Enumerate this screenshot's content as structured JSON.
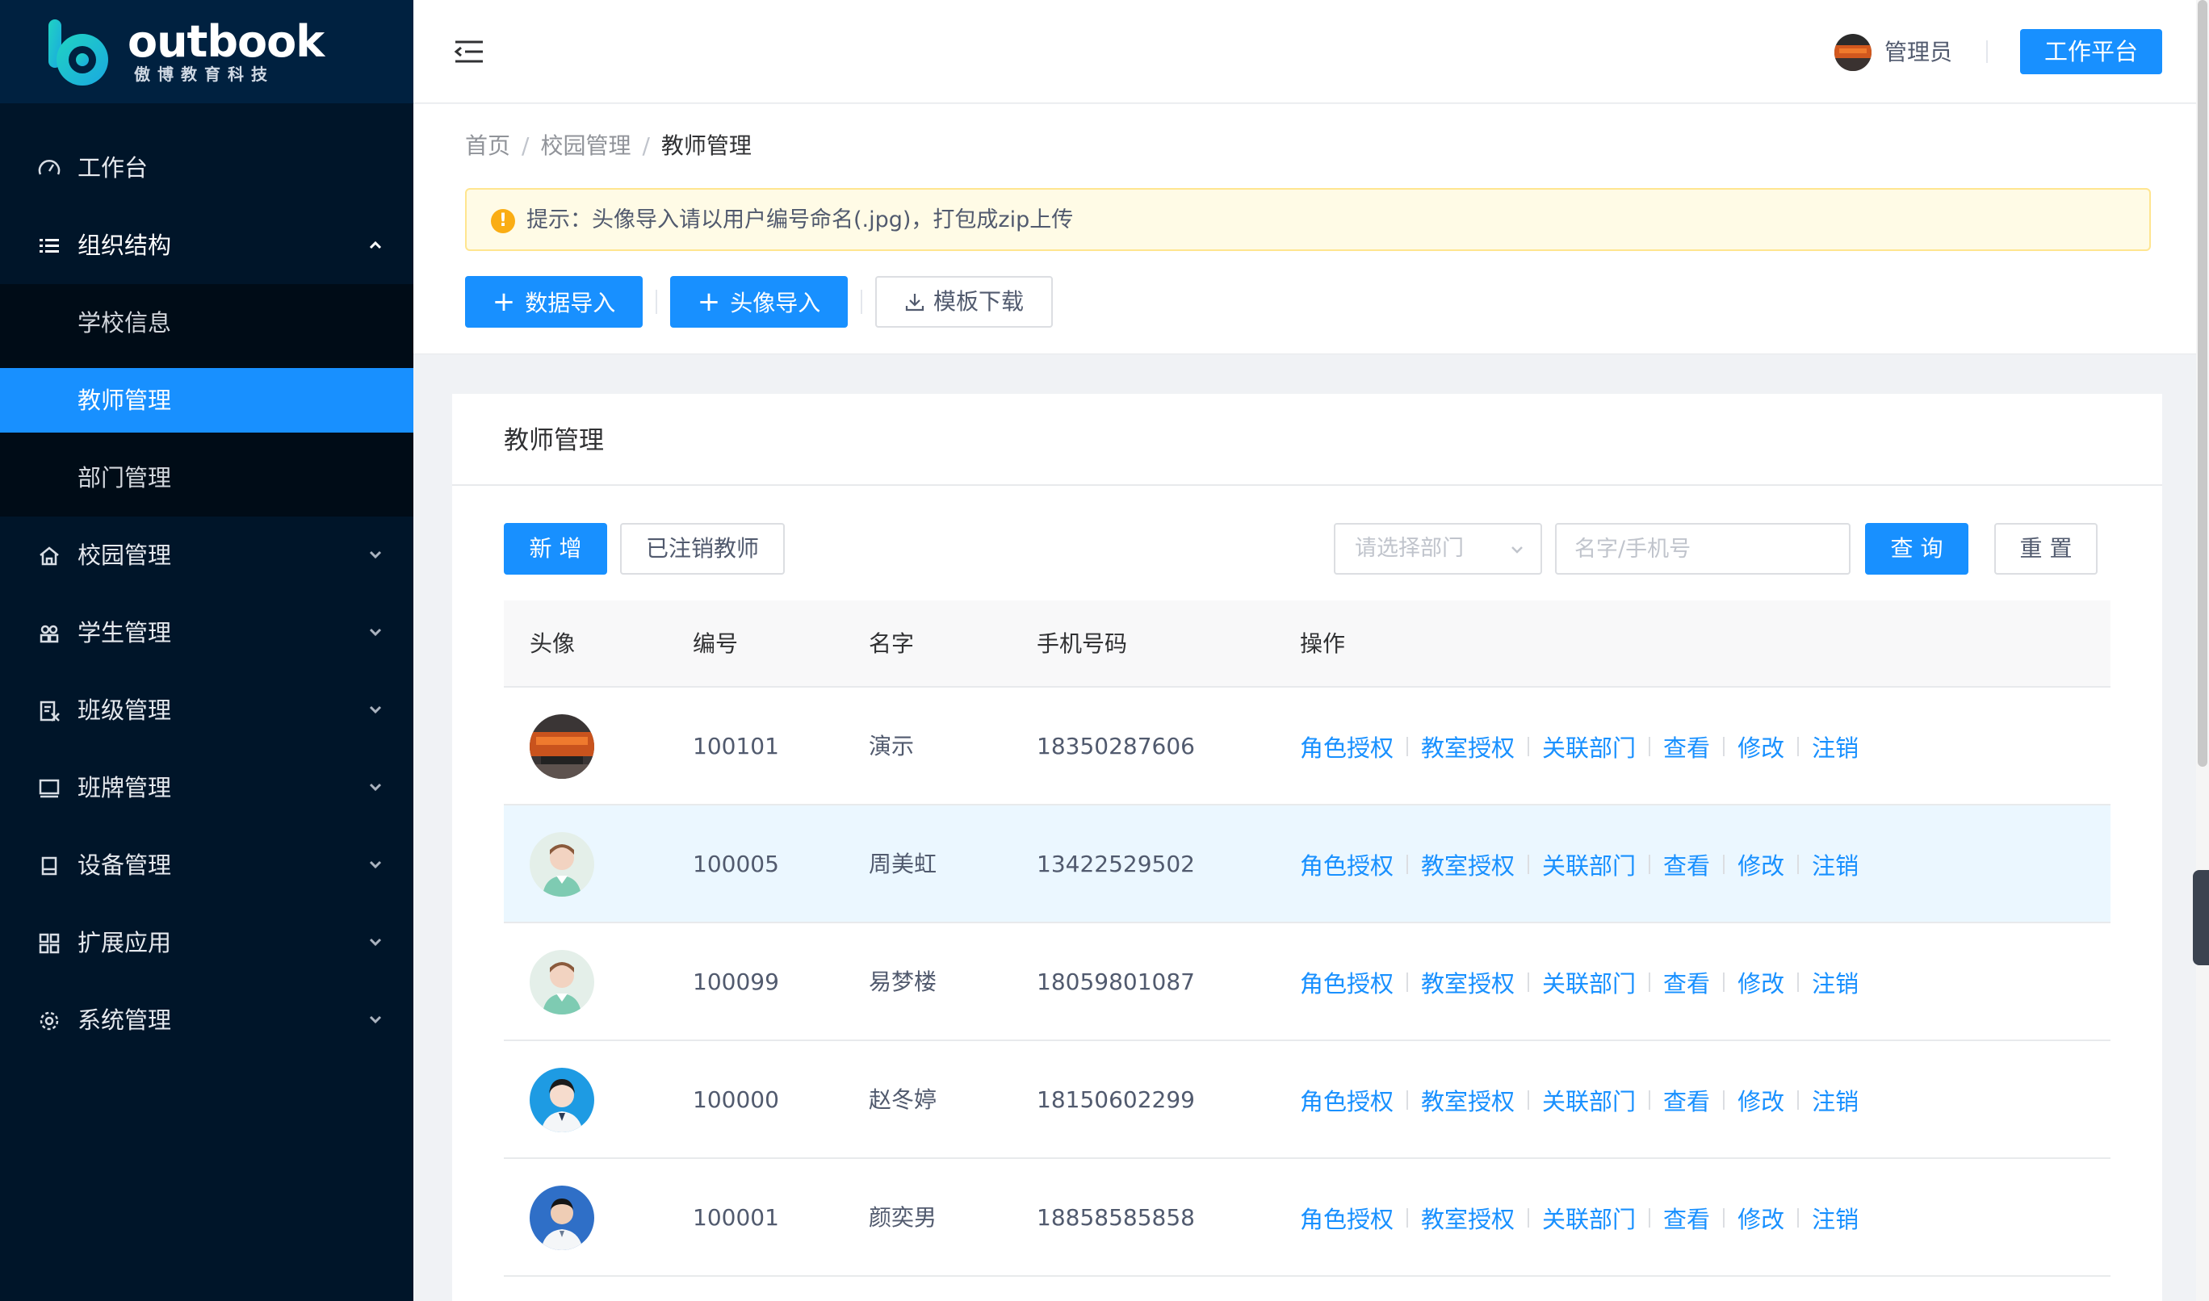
{
  "brand": {
    "name": "outbook",
    "tagline": "傲博教育科技",
    "color": "#1890ff"
  },
  "sidebar": {
    "items": [
      {
        "label": "工作台",
        "icon": "dashboard-icon"
      },
      {
        "label": "组织结构",
        "icon": "list-icon",
        "expanded": true,
        "children": [
          {
            "label": "学校信息"
          },
          {
            "label": "教师管理",
            "active": true
          },
          {
            "label": "部门管理"
          }
        ]
      },
      {
        "label": "校园管理",
        "icon": "home-icon"
      },
      {
        "label": "学生管理",
        "icon": "students-icon"
      },
      {
        "label": "班级管理",
        "icon": "class-icon"
      },
      {
        "label": "班牌管理",
        "icon": "monitor-icon"
      },
      {
        "label": "设备管理",
        "icon": "device-icon"
      },
      {
        "label": "扩展应用",
        "icon": "apps-grid-icon"
      },
      {
        "label": "系统管理",
        "icon": "gear-icon"
      }
    ]
  },
  "header": {
    "user_name": "管理员",
    "workspace_button": "工作平台"
  },
  "breadcrumb": [
    "首页",
    "校园管理",
    "教师管理"
  ],
  "breadcrumb_sep": "/",
  "alert": {
    "text": "提示：头像导入请以用户编号命名(.jpg)，打包成zip上传"
  },
  "toolbar": {
    "import_data": "数据导入",
    "import_avatar": "头像导入",
    "download_template": "模板下载"
  },
  "card": {
    "title": "教师管理",
    "add_button": "新 增",
    "cancelled_button": "已注销教师",
    "dept_select_placeholder": "请选择部门",
    "search_placeholder": "名字/手机号",
    "search_button": "查 询",
    "reset_button": "重 置"
  },
  "table": {
    "columns": [
      "头像",
      "编号",
      "名字",
      "手机号码",
      "操作"
    ],
    "actions": [
      "角色授权",
      "教室授权",
      "关联部门",
      "查看",
      "修改",
      "注销"
    ],
    "rows": [
      {
        "avatar": "car-photo",
        "id": "100101",
        "name": "演示",
        "phone": "18350287606"
      },
      {
        "avatar": "male-cartoon",
        "id": "100005",
        "name": "周美虹",
        "phone": "13422529502",
        "highlighted": true
      },
      {
        "avatar": "male-cartoon",
        "id": "100099",
        "name": "易梦楼",
        "phone": "18059801087"
      },
      {
        "avatar": "female-photo",
        "id": "100000",
        "name": "赵冬婷",
        "phone": "18150602299"
      },
      {
        "avatar": "male-photo",
        "id": "100001",
        "name": "颜奕男",
        "phone": "18858585858"
      }
    ]
  }
}
